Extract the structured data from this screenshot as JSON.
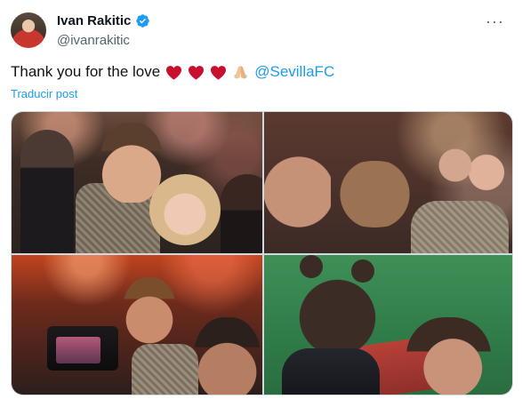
{
  "header": {
    "display_name": "Ivan Rakitic",
    "handle": "@ivanrakitic",
    "verified_icon": "verified-badge-icon",
    "more_icon": "more-options-icon",
    "more_glyph": "···"
  },
  "tweet": {
    "text": "Thank you for the love",
    "emojis": [
      "red-heart-icon",
      "red-heart-icon",
      "red-heart-icon",
      "folded-hands-icon"
    ],
    "mention": "@SevillaFC",
    "translate_label": "Traducir post"
  },
  "colors": {
    "accent": "#1d9bf0",
    "heart": "#c8102e",
    "text": "#0f1419",
    "muted": "#536471"
  }
}
